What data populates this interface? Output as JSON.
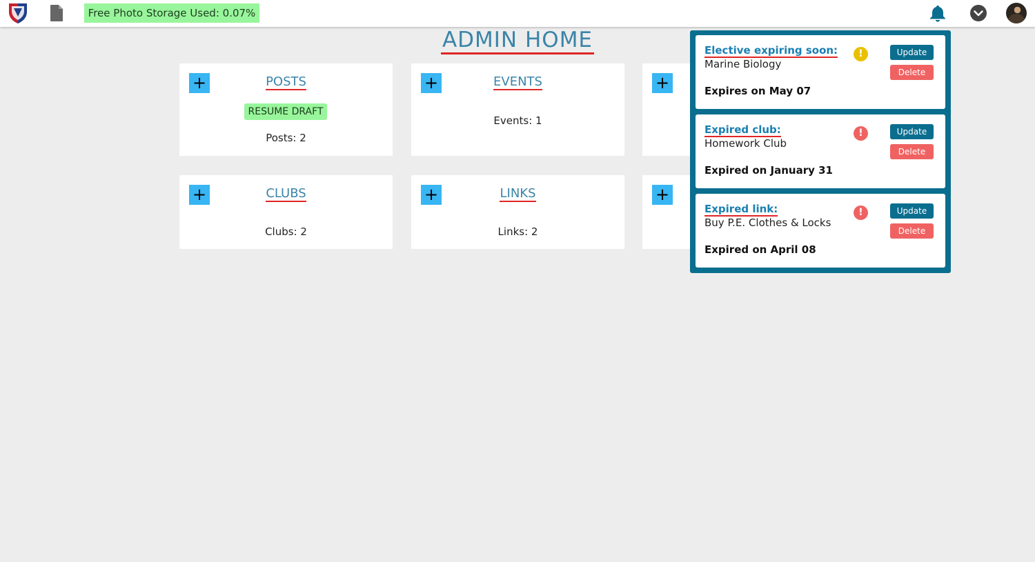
{
  "topbar": {
    "storage_text": "Free Photo Storage Used: 0.07%",
    "icons": [
      "school-crest-logo",
      "document-icon",
      "bell-icon",
      "chevron-down-icon",
      "avatar"
    ]
  },
  "page": {
    "title": "ADMIN HOME"
  },
  "cards": [
    {
      "title": "POSTS",
      "count": "Posts: 2",
      "draft_label": "RESUME DRAFT"
    },
    {
      "title": "EVENTS",
      "count": "Events: 1"
    },
    {
      "title": "CLUBS",
      "count": "Clubs: 2"
    },
    {
      "title": "LINKS",
      "count": "Links: 2"
    }
  ],
  "notifications": [
    {
      "heading": "Elective expiring soon:",
      "name": "Marine Biology",
      "date": "Expires on May 07",
      "severity": "warning",
      "severity_color": "#e8c100"
    },
    {
      "heading": "Expired club:",
      "name": "Homework Club",
      "date": "Expired on January 31",
      "severity": "error",
      "severity_color": "#f06262"
    },
    {
      "heading": "Expired link:",
      "name": "Buy P.E. Clothes & Locks",
      "date": "Expired on April 08",
      "severity": "error",
      "severity_color": "#f06262"
    }
  ],
  "buttons": {
    "update": "Update",
    "delete": "Delete",
    "plus": "+",
    "alert_glyph": "!"
  },
  "colors": {
    "accent": "#0b6e8f",
    "plus": "#38b5f3",
    "storage_bg": "#98f59b",
    "danger": "#f06262",
    "link": "#3b84a8"
  }
}
